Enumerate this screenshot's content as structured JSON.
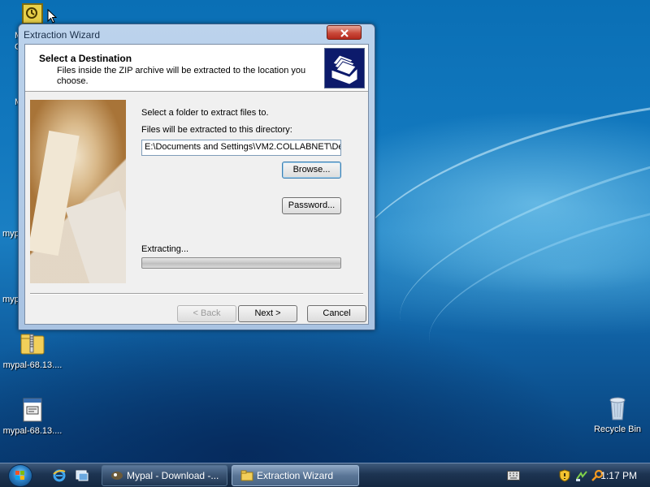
{
  "desktop": {
    "icons": [
      {
        "label": "M",
        "name": "desktop-icon-partial-1"
      },
      {
        "label": "mypal-68.13....",
        "name": "desktop-icon-mypal-zip"
      },
      {
        "label": "mypal-68.13....",
        "name": "desktop-icon-mypal-exe"
      },
      {
        "label": "Recycle Bin",
        "name": "desktop-icon-recycle-bin"
      }
    ],
    "partial_labels": [
      "M",
      "C",
      "M",
      "myp",
      "myp"
    ]
  },
  "window": {
    "title": "Extraction Wizard",
    "close_label": "x",
    "header": {
      "title": "Select a Destination",
      "description": "Files inside the ZIP archive will be extracted to the location you choose."
    },
    "select_label": "Select a folder to extract files to.",
    "dir_label": "Files will be extracted to this directory:",
    "dir_value": "E:\\Documents and Settings\\VM2.COLLABNET\\De",
    "browse_label": "Browse...",
    "password_label": "Password...",
    "extracting_label": "Extracting...",
    "progress_fraction": 0,
    "back_label": "< Back",
    "next_label": "Next >",
    "cancel_label": "Cancel"
  },
  "taskbar": {
    "tasks": [
      {
        "label": "Mypal - Download -...",
        "active": false
      },
      {
        "label": "Extraction Wizard",
        "active": true
      }
    ],
    "clock": "1:17 PM"
  },
  "colors": {
    "title_text": "#1b2f4a",
    "close_red": "#c9493a",
    "focus_blue": "#3c7fb1"
  }
}
